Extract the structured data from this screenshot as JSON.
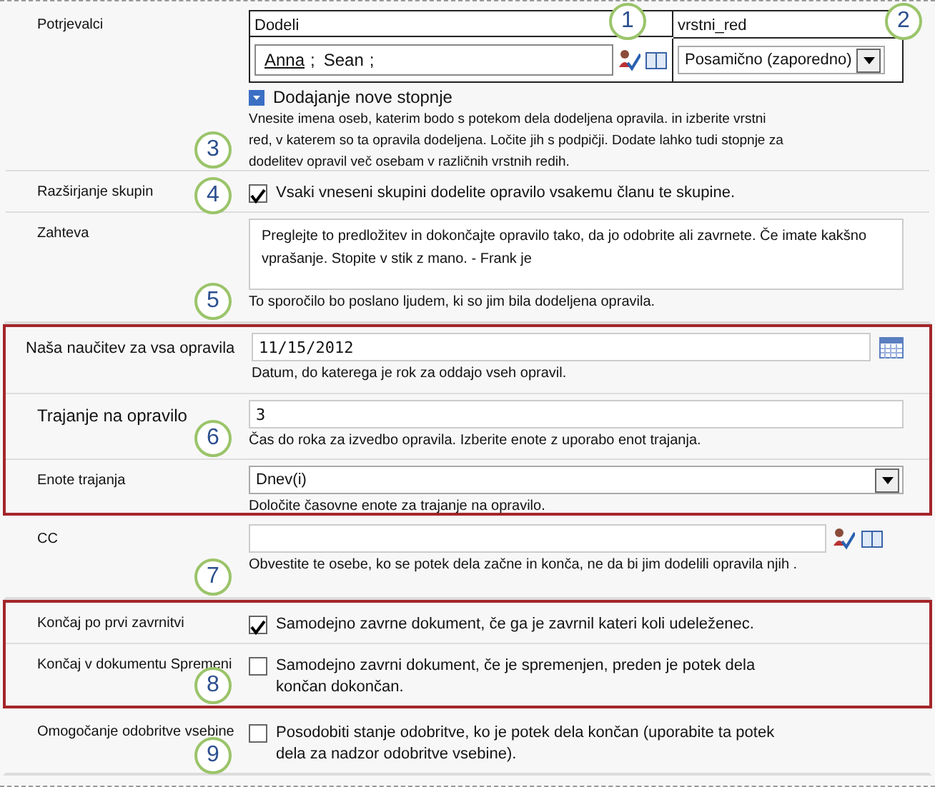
{
  "groups": [
    {
      "highlighted": false,
      "rows": [
        {
          "kind": "approvers",
          "label": "Potrjevalci",
          "callout": "3",
          "assign_header": "Dodeli",
          "assign_callout": "1",
          "order_header": "vrstni_red",
          "order_callout": "2",
          "people": [
            {
              "name": "Anna",
              "resolved": true,
              "separator": ";"
            },
            {
              "name": "Sean",
              "resolved": false,
              "separator": ";"
            }
          ],
          "order_value": "Posamično (zaporedno)",
          "add_stage": "Dodajanje nove stopnje",
          "description": "Vnesite imena oseb, katerim bodo s potekom dela dodeljena opravila. in izberite vrstni red, v katerem so ta opravila dodeljena. Ločite jih s podpičji. Dodate lahko tudi stopnje za dodelitev opravil več osebam v različnih vrstnih redih."
        },
        {
          "kind": "checkbox",
          "label": "Razširjanje skupin",
          "callout": "4",
          "checked": true,
          "text": "Vsaki vneseni skupini dodelite opravilo vsakemu članu te skupine."
        },
        {
          "kind": "textarea",
          "label": "Zahteva",
          "callout": "5",
          "value": "Preglejte to predložitev in dokončajte opravilo tako, da jo odobrite ali zavrnete. Če imate kakšno vprašanje. Stopite v stik z mano. - Frank je",
          "description": "To sporočilo bo poslano ljudem, ki so jim bila dodeljena opravila."
        }
      ]
    },
    {
      "highlighted": true,
      "rows": [
        {
          "kind": "date",
          "label": "Naša naučitev za vsa opravila",
          "value": "11/15/2012",
          "description": "Datum, do katerega je rok za oddajo vseh opravil."
        },
        {
          "kind": "text",
          "label": "Trajanje na opravilo",
          "callout": "6",
          "value": "3",
          "description": "Čas do roka za izvedbo opravila. Izberite enote z uporabo enot trajanja."
        },
        {
          "kind": "select",
          "label": "Enote trajanja",
          "value": "Dnev(i)",
          "description": "Določite časovne enote za trajanje na opravilo."
        }
      ]
    },
    {
      "highlighted": false,
      "rows": [
        {
          "kind": "people",
          "label": "CC",
          "callout": "7",
          "description": "Obvestite te osebe, ko se potek dela začne in konča, ne da bi jim dodelili opravila njih ."
        }
      ]
    },
    {
      "highlighted": true,
      "rows": [
        {
          "kind": "checkbox",
          "label": "Končaj po prvi zavrnitvi",
          "checked": true,
          "text": "Samodejno zavrne dokument, če ga je zavrnil kateri koli udeleženec."
        },
        {
          "kind": "checkbox",
          "label": "Končaj v dokumentu Spremeni",
          "callout": "8",
          "checked": false,
          "text": "Samodejno zavrni dokument, če je spremenjen, preden je potek dela končan dokončan."
        }
      ]
    },
    {
      "highlighted": false,
      "rows": [
        {
          "kind": "checkbox",
          "label": "Omogočanje odobritve vsebine",
          "callout": "9",
          "checked": false,
          "text": "Posodobiti stanje odobritve, ko je potek dela končan (uporabite ta potek dela za nadzor odobritve vsebine)."
        }
      ]
    }
  ]
}
